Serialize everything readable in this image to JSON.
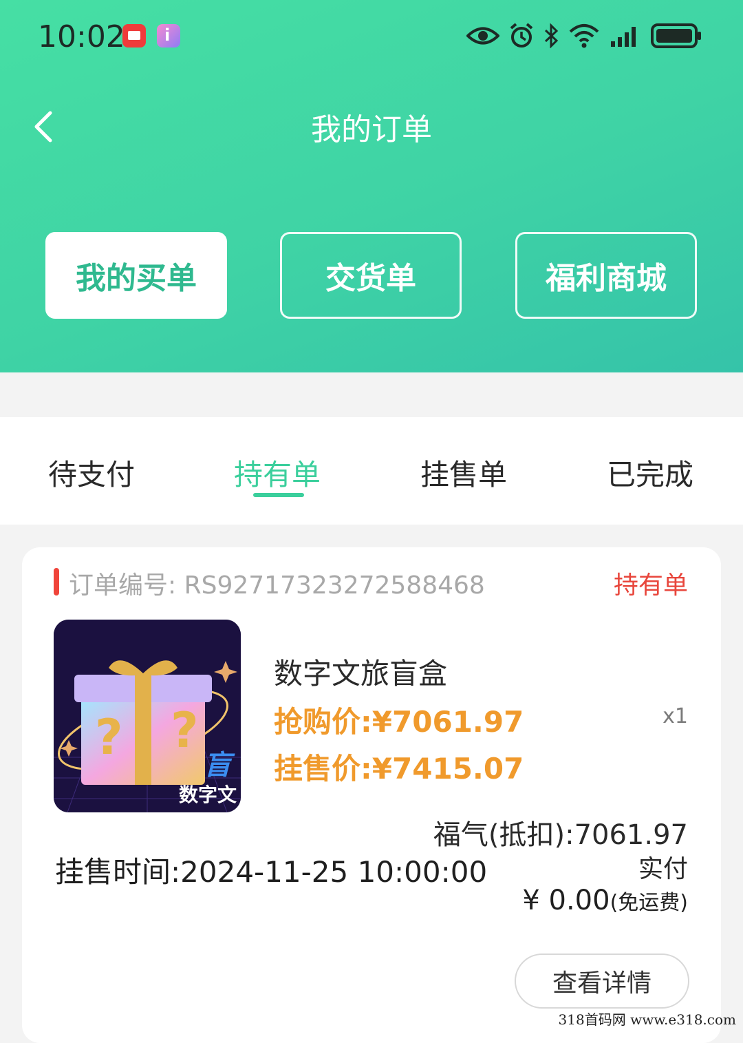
{
  "status_bar": {
    "time": "10:02"
  },
  "header": {
    "title": "我的订单"
  },
  "segments": [
    {
      "label": "我的买单",
      "active": true
    },
    {
      "label": "交货单",
      "active": false
    },
    {
      "label": "福利商城",
      "active": false
    }
  ],
  "tabs": [
    {
      "label": "待支付",
      "active": false
    },
    {
      "label": "持有单",
      "active": true
    },
    {
      "label": "挂售单",
      "active": false
    },
    {
      "label": "已完成",
      "active": false
    }
  ],
  "order": {
    "number_label": "订单编号:",
    "number": "RS927173232725884​68",
    "status": "持有单",
    "thumb_text": "数字文",
    "thumb_badge": "盲",
    "product_name": "数字文旅盲盒",
    "buy_price": "抢购价:¥7061.97",
    "sale_price": "挂售价:¥7415.07",
    "quantity": "x1",
    "points": "福气(抵扣):7061.97",
    "sale_time": "挂售时间:2024-11-25 10:00:00",
    "paid_label": "实付",
    "paid_amount": "¥ 0.00",
    "paid_note": "(免运费)",
    "detail_button": "查看详情"
  },
  "watermark": "318首码网   www.e318.com",
  "colors": {
    "header_start": "#46dfa4",
    "header_end": "#35c3a9",
    "accent_green": "#3bcf9c",
    "price_orange": "#f09a2c",
    "status_red": "#e8463c"
  }
}
